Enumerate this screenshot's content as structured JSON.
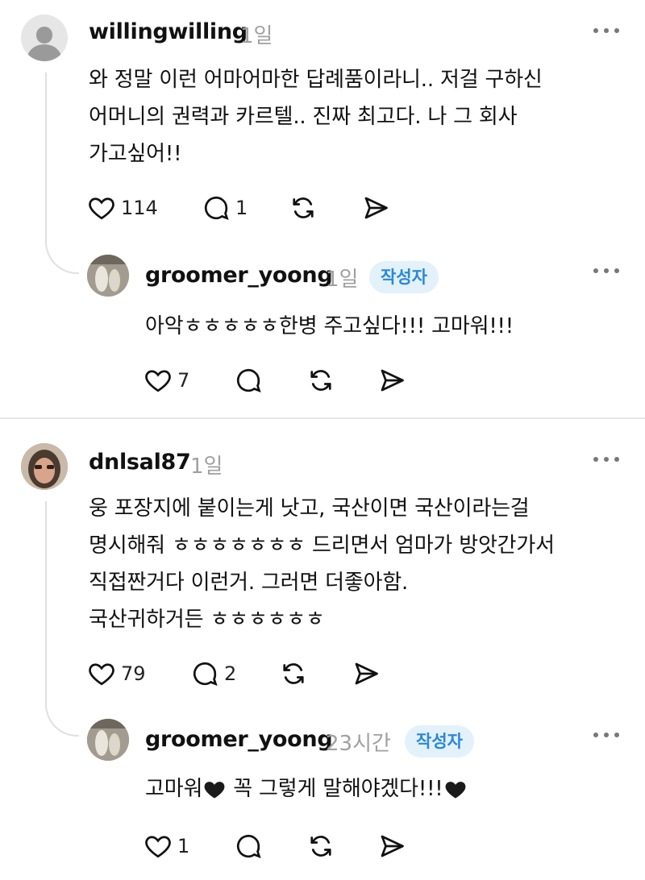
{
  "comments": [
    {
      "username": "willingwilling",
      "time": "1일",
      "lines": [
        "와 정말 이런 어마어마한 답례품이라니.. 저걸 구하신",
        "어머니의 권력과 카르텔.. 진짜 최고다. 나 그 회사",
        "가고싶어!!"
      ],
      "likes": "114",
      "replies": "1"
    },
    {
      "username": "groomer_yoong",
      "time": "1일",
      "badge": "작성자",
      "lines": [
        "아악ㅎㅎㅎㅎㅎ한병 주고싶다!!! 고마워!!!"
      ],
      "likes": "7"
    },
    {
      "username": "dnlsal87",
      "time": "1일",
      "lines": [
        "웅 포장지에 붙이는게 낫고, 국산이면 국산이라는걸",
        "명시해줘 ㅎㅎㅎㅎㅎㅎㅎ 드리면서 엄마가 방앗간가서",
        "직접짠거다 이런거. 그러면 더좋아함.",
        "국산귀하거든 ㅎㅎㅎㅎㅎㅎ"
      ],
      "likes": "79",
      "replies": "2"
    },
    {
      "username": "groomer_yoong",
      "time": "23시간",
      "badge": "작성자",
      "text_a": "고마워",
      "text_b": " 꼭 그렇게 말해야겠다!!!",
      "likes": "1"
    }
  ],
  "icons": {
    "like": "heart-icon",
    "reply": "comment-bubble-icon",
    "repost": "repost-icon",
    "share": "send-icon",
    "more": "more-options-icon",
    "emoji": "black-heart-icon"
  },
  "colors": {
    "badge_bg": "#e3f1fb",
    "badge_text": "#2b88d9",
    "muted": "#a0a0a0"
  }
}
